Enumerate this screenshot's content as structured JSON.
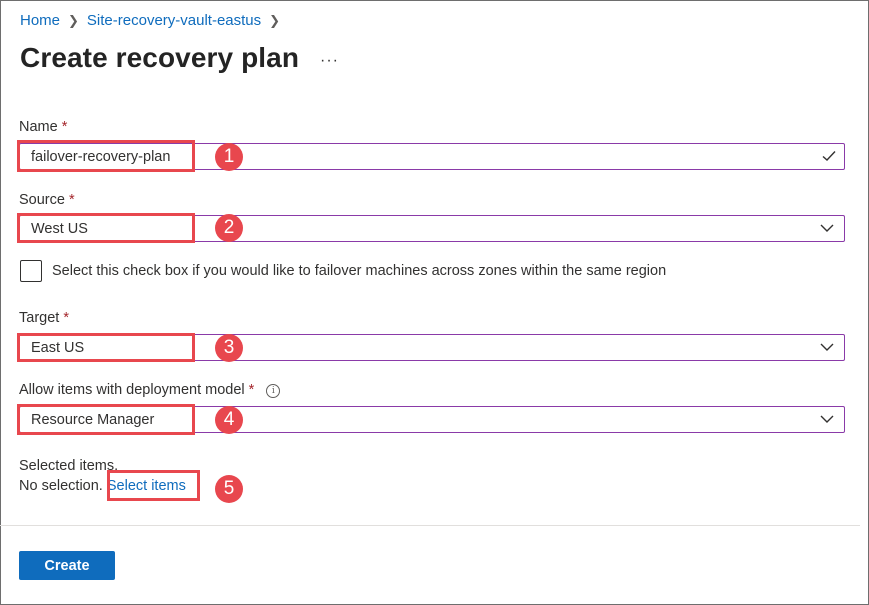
{
  "breadcrumb": {
    "items": [
      "Home",
      "Site-recovery-vault-eastus"
    ]
  },
  "page": {
    "title": "Create recovery plan",
    "more_label": "···"
  },
  "form": {
    "required_mark": "*",
    "name": {
      "label": "Name",
      "value": "failover-recovery-plan",
      "valid": true
    },
    "source": {
      "label": "Source",
      "value": "West US"
    },
    "zones_checkbox": {
      "label": "Select this check box if you would like to failover machines across zones within the same region",
      "checked": false
    },
    "target": {
      "label": "Target",
      "value": "East US"
    },
    "deployment_model": {
      "label": "Allow items with deployment model",
      "value": "Resource Manager",
      "info_icon": "info-icon"
    },
    "selected_items": {
      "label": "Selected items.",
      "empty_text": "No selection.",
      "link_label": "Select items"
    }
  },
  "annotations": [
    "1",
    "2",
    "3",
    "4",
    "5"
  ],
  "footer": {
    "create_label": "Create"
  },
  "colors": {
    "accent": "#0f6cbd",
    "field_border": "#8a3aa8",
    "annotation_red": "#e8474e",
    "required_red": "#a4262c"
  }
}
